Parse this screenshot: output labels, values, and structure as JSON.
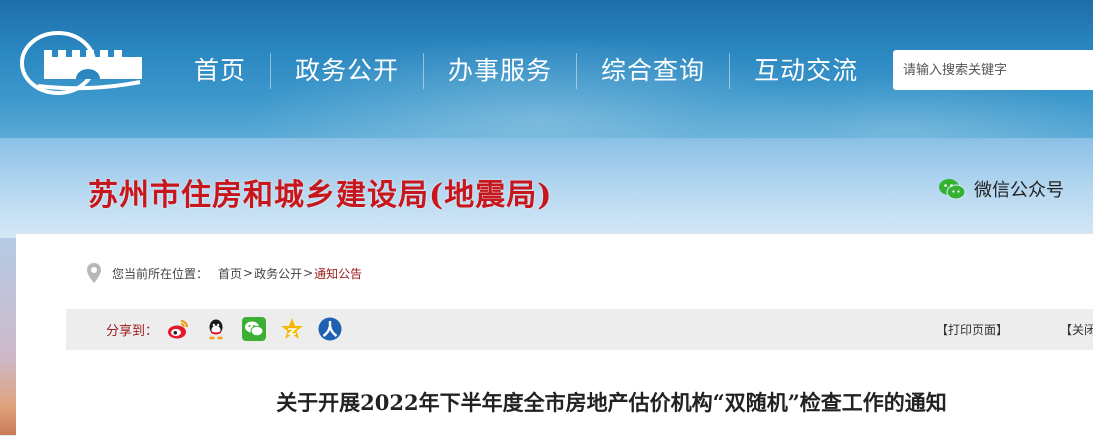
{
  "nav": {
    "items": [
      {
        "label": "首页"
      },
      {
        "label": "政务公开"
      },
      {
        "label": "办事服务"
      },
      {
        "label": "综合查询"
      },
      {
        "label": "互动交流"
      }
    ]
  },
  "search": {
    "placeholder": "请输入搜索关键字"
  },
  "header": {
    "site_title": "苏州市住房和城乡建设局(地震局)",
    "wechat_label": "微信公众号"
  },
  "breadcrumb": {
    "prefix": "您当前所在位置：",
    "items": [
      "首页",
      "政务公开",
      "通知公告"
    ],
    "separator": ">"
  },
  "share": {
    "label": "分享到：",
    "icons": [
      "weibo-icon",
      "qq-icon",
      "wechat-icon",
      "qzone-icon",
      "renren-icon"
    ]
  },
  "tools": {
    "print_label": "【打印页面】",
    "close_label": "【关闭"
  },
  "article": {
    "title": "关于开展2022年下半年度全市房地产估价机构“双随机”检查工作的通知"
  },
  "colors": {
    "title_red": "#c8161d",
    "accent_red": "#9c1b1b",
    "nav_blue": "#2a86bf"
  }
}
